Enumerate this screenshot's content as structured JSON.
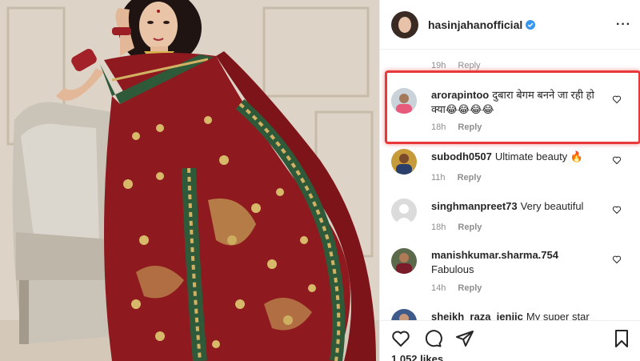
{
  "post": {
    "username": "hasinjahanofficial",
    "likes": "1,052 likes"
  },
  "top_meta": {
    "time": "19h",
    "reply": "Reply"
  },
  "comments": [
    {
      "user": "arorapintoo",
      "text": "दुबारा बेगम बनने जा रही हो क्या😂😂😂😂",
      "time": "18h",
      "reply": "Reply"
    },
    {
      "user": "subodh0507",
      "text": "Ultimate beauty 🔥",
      "time": "11h",
      "reply": "Reply"
    },
    {
      "user": "singhmanpreet73",
      "text": "Very beautiful",
      "time": "18h",
      "reply": "Reply"
    },
    {
      "user": "manishkumar.sharma.754",
      "text": "Fabulous",
      "time": "14h",
      "reply": "Reply"
    },
    {
      "user": "sheikh_raza_jeniic",
      "text": "My super star"
    }
  ],
  "icons": {
    "more": "more-options-icon",
    "verified": "verified-badge-icon",
    "like": "heart-outline-icon",
    "comment": "comment-bubble-icon",
    "share": "paper-plane-icon",
    "save": "bookmark-icon"
  },
  "colors": {
    "verified": "#3897f0",
    "highlight": "#e8393a",
    "saree": "#8e1a1f",
    "border_trim": "#2f5a3a"
  }
}
